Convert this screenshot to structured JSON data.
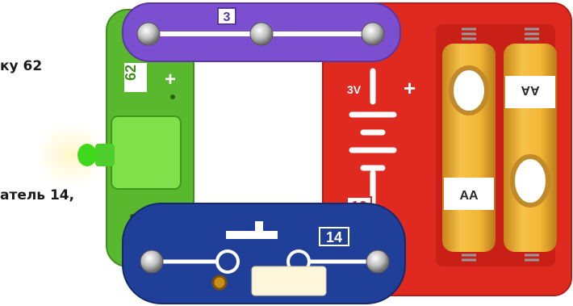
{
  "captions": {
    "line1": "ку 62",
    "line2": "атель 14,"
  },
  "parts": {
    "wire": {
      "number": "3"
    },
    "led": {
      "number": "62",
      "polarity": "+"
    },
    "battery": {
      "number": "19",
      "voltage": "3V",
      "polarity": "+",
      "cell_left": "AA",
      "cell_right": "AA"
    },
    "switch": {
      "number": "14"
    }
  },
  "colors": {
    "wire_purple": "#7b4fcf",
    "led_board_green": "#5ab82e",
    "battery_red": "#e02a1f",
    "switch_blue": "#1f3f98",
    "battery_cell": "#f2b632"
  }
}
